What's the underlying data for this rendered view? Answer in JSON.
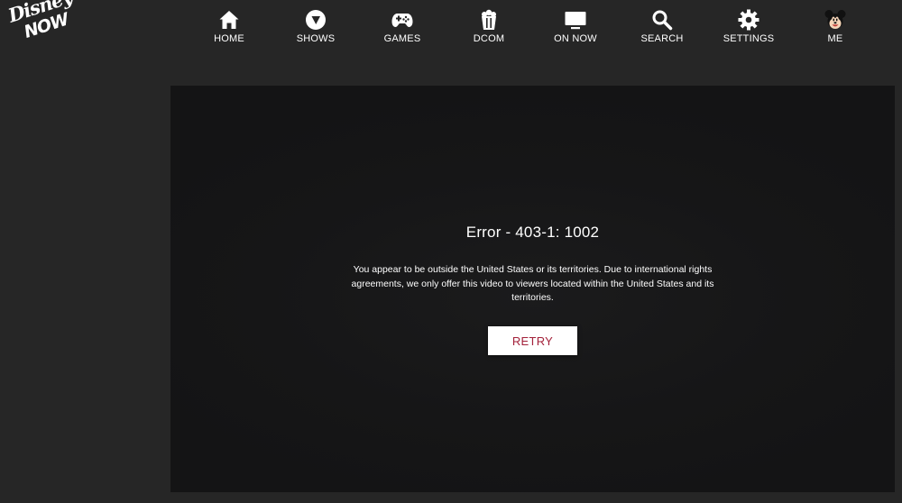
{
  "app": {
    "logo_top": "Disney",
    "logo_bottom": "NOW"
  },
  "nav": {
    "items": [
      {
        "label": "HOME",
        "icon": "home-icon"
      },
      {
        "label": "SHOWS",
        "icon": "play-icon"
      },
      {
        "label": "GAMES",
        "icon": "gamepad-icon"
      },
      {
        "label": "DCOM",
        "icon": "popcorn-icon"
      },
      {
        "label": "ON NOW",
        "icon": "tv-icon"
      },
      {
        "label": "SEARCH",
        "icon": "search-icon"
      },
      {
        "label": "SETTINGS",
        "icon": "gear-icon"
      },
      {
        "label": "ME",
        "icon": "mickey-avatar-icon"
      }
    ]
  },
  "error": {
    "title": "Error - 403-1: 1002",
    "message": "You appear to be outside the United States or its territories. Due to international rights agreements, we only offer this video to viewers located within the United States and its territories.",
    "retry_label": "RETRY"
  },
  "colors": {
    "background": "#262626",
    "player_background": "#161617",
    "retry_text": "#a3213a",
    "text": "#ffffff"
  }
}
